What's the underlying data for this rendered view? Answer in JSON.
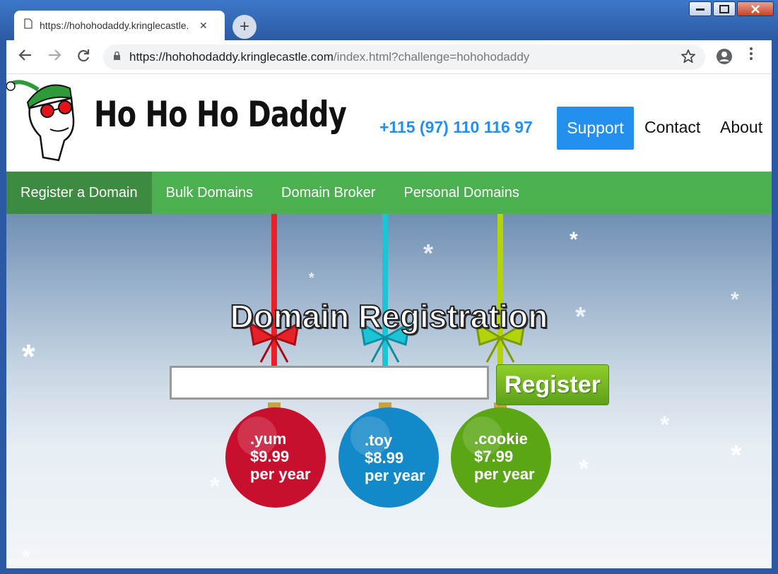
{
  "browser": {
    "tab_title": "https://hohohodaddy.kringlecastle.",
    "tab_close": "✕",
    "new_tab": "+",
    "url_host": "https://hohohodaddy.kringlecastle.com",
    "url_path": "/index.html?challenge=hohohodaddy"
  },
  "header": {
    "logo_text": "Ho Ho Ho Daddy",
    "phone": "+115 (97) 110 116 97",
    "support_label": "Support",
    "contact_label": "Contact",
    "about_label": "About"
  },
  "nav": {
    "items": [
      {
        "label": "Register a Domain"
      },
      {
        "label": "Bulk Domains"
      },
      {
        "label": "Domain Broker"
      },
      {
        "label": "Personal Domains"
      }
    ]
  },
  "hero": {
    "title": "Domain Registration",
    "register_label": "Register",
    "ornaments": [
      {
        "tld": ".yum",
        "price": "$9.99",
        "period": "per year",
        "color": "#c8102e",
        "ribbon": "#e8202a"
      },
      {
        "tld": ".toy",
        "price": "$8.99",
        "period": "per year",
        "color": "#1389c9",
        "ribbon": "#1bc4d6"
      },
      {
        "tld": ".cookie",
        "price": "$7.99",
        "period": "per year",
        "color": "#5aa615",
        "ribbon": "#b4d40a"
      }
    ]
  },
  "colors": {
    "accent_blue": "#2390f0",
    "nav_green": "#4caf50",
    "nav_active": "#3d8b40"
  },
  "icons": [
    "page-icon",
    "back-icon",
    "forward-icon",
    "reload-icon",
    "lock-icon",
    "star-icon",
    "profile-icon",
    "menu-icon",
    "minimize-icon",
    "maximize-icon",
    "close-icon"
  ]
}
